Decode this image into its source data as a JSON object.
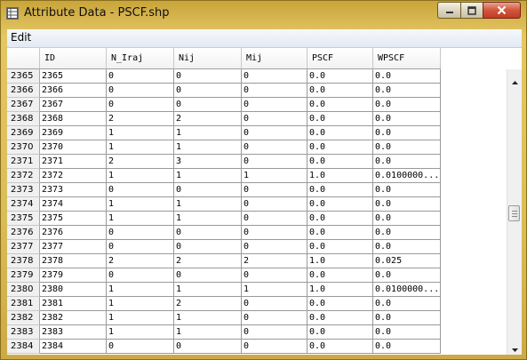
{
  "window": {
    "title": "Attribute Data - PSCF.shp"
  },
  "menu": {
    "items": [
      {
        "label": "Edit"
      }
    ]
  },
  "table": {
    "columns": [
      "ID",
      "N_Iraj",
      "Nij",
      "Mij",
      "PSCF",
      "WPSCF"
    ],
    "rows": [
      {
        "rownum": "2365",
        "cells": [
          "2365",
          "0",
          "0",
          "0",
          "0.0",
          "0.0"
        ]
      },
      {
        "rownum": "2366",
        "cells": [
          "2366",
          "0",
          "0",
          "0",
          "0.0",
          "0.0"
        ]
      },
      {
        "rownum": "2367",
        "cells": [
          "2367",
          "0",
          "0",
          "0",
          "0.0",
          "0.0"
        ]
      },
      {
        "rownum": "2368",
        "cells": [
          "2368",
          "2",
          "2",
          "0",
          "0.0",
          "0.0"
        ]
      },
      {
        "rownum": "2369",
        "cells": [
          "2369",
          "1",
          "1",
          "0",
          "0.0",
          "0.0"
        ]
      },
      {
        "rownum": "2370",
        "cells": [
          "2370",
          "1",
          "1",
          "0",
          "0.0",
          "0.0"
        ]
      },
      {
        "rownum": "2371",
        "cells": [
          "2371",
          "2",
          "3",
          "0",
          "0.0",
          "0.0"
        ]
      },
      {
        "rownum": "2372",
        "cells": [
          "2372",
          "1",
          "1",
          "1",
          "1.0",
          "0.0100000..."
        ]
      },
      {
        "rownum": "2373",
        "cells": [
          "2373",
          "0",
          "0",
          "0",
          "0.0",
          "0.0"
        ]
      },
      {
        "rownum": "2374",
        "cells": [
          "2374",
          "1",
          "1",
          "0",
          "0.0",
          "0.0"
        ]
      },
      {
        "rownum": "2375",
        "cells": [
          "2375",
          "1",
          "1",
          "0",
          "0.0",
          "0.0"
        ]
      },
      {
        "rownum": "2376",
        "cells": [
          "2376",
          "0",
          "0",
          "0",
          "0.0",
          "0.0"
        ]
      },
      {
        "rownum": "2377",
        "cells": [
          "2377",
          "0",
          "0",
          "0",
          "0.0",
          "0.0"
        ]
      },
      {
        "rownum": "2378",
        "cells": [
          "2378",
          "2",
          "2",
          "2",
          "1.0",
          "0.025"
        ]
      },
      {
        "rownum": "2379",
        "cells": [
          "2379",
          "0",
          "0",
          "0",
          "0.0",
          "0.0"
        ]
      },
      {
        "rownum": "2380",
        "cells": [
          "2380",
          "1",
          "1",
          "1",
          "1.0",
          "0.0100000..."
        ]
      },
      {
        "rownum": "2381",
        "cells": [
          "2381",
          "1",
          "2",
          "0",
          "0.0",
          "0.0"
        ]
      },
      {
        "rownum": "2382",
        "cells": [
          "2382",
          "1",
          "1",
          "0",
          "0.0",
          "0.0"
        ]
      },
      {
        "rownum": "2383",
        "cells": [
          "2383",
          "1",
          "1",
          "0",
          "0.0",
          "0.0"
        ]
      },
      {
        "rownum": "2384",
        "cells": [
          "2384",
          "0",
          "0",
          "0",
          "0.0",
          "0.0"
        ]
      }
    ]
  },
  "scrollbar": {
    "position_fraction": 0.5
  },
  "icons": {
    "app": "table-icon",
    "minimize": "minimize-icon",
    "maximize": "maximize-icon",
    "close": "close-icon",
    "scroll_up": "chevron-up-icon",
    "scroll_down": "chevron-down-icon"
  },
  "colors": {
    "frame": "#d9bd57",
    "close_button": "#c23b22",
    "menubar": "#e3e9f2"
  }
}
